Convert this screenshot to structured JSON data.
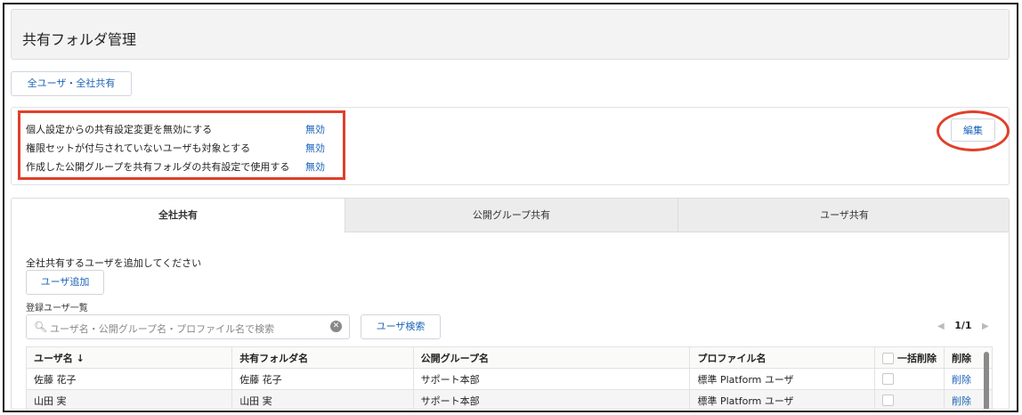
{
  "header": {
    "title": "共有フォルダ管理"
  },
  "scope_button": "全ユーザ・全社共有",
  "settings": {
    "rows": [
      {
        "label": "個人設定からの共有設定変更を無効にする",
        "value": "無効"
      },
      {
        "label": "権限セットが付与されていないユーザも対象とする",
        "value": "無効"
      },
      {
        "label": "作成した公開グループを共有フォルダの共有設定で使用する",
        "value": "無効"
      }
    ],
    "edit_label": "編集"
  },
  "tabs": [
    {
      "label": "全社共有",
      "active": true
    },
    {
      "label": "公開グループ共有",
      "active": false
    },
    {
      "label": "ユーザ共有",
      "active": false
    }
  ],
  "main": {
    "instruction": "全社共有するユーザを追加してください",
    "add_button": "ユーザ追加",
    "list_label": "登録ユーザ一覧",
    "search_placeholder": "ユーザ名・公開グループ名・プロファイル名で検索",
    "search_button": "ユーザ検索",
    "pager": "1/1"
  },
  "table": {
    "headers": [
      "ユーザ名 ↓",
      "共有フォルダ名",
      "公開グループ名",
      "プロファイル名",
      "一括削除",
      "削除"
    ],
    "rows": [
      [
        "佐藤 花子",
        "佐藤 花子",
        "サポート本部",
        "標準 Platform ユーザ",
        "",
        "削除"
      ],
      [
        "山田 実",
        "山田 実",
        "サポート本部",
        "標準 Platform ユーザ",
        "",
        "削除"
      ]
    ]
  },
  "colors": {
    "accent": "#1a63b8",
    "highlight": "#e0402a"
  }
}
